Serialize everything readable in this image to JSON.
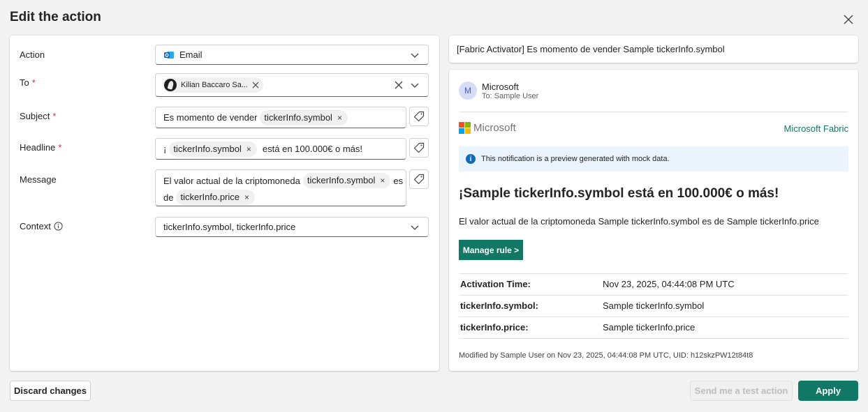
{
  "dialog": {
    "title": "Edit the action",
    "close_icon": "close-icon"
  },
  "form": {
    "action": {
      "label": "Action",
      "value": "Email",
      "icon": "outlook-icon"
    },
    "to": {
      "label": "To",
      "required_mark": "*",
      "recipient": "Kilian Baccaro Sa..."
    },
    "subject": {
      "label": "Subject",
      "required_mark": "*",
      "text_before": "Es momento de vender",
      "token": "tickerInfo.symbol"
    },
    "headline": {
      "label": "Headline",
      "required_mark": "*",
      "text_before": "¡",
      "token": "tickerInfo.symbol",
      "text_after": "está en 100.000€ o más!"
    },
    "message": {
      "label": "Message",
      "line1_text": "El valor actual de la criptomoneda",
      "line1_token": "tickerInfo.symbol",
      "line1_after": "es",
      "line2_text": "de",
      "line2_token": "tickerInfo.price"
    },
    "context": {
      "label": "Context",
      "value": "tickerInfo.symbol, tickerInfo.price"
    },
    "token_remove": "×"
  },
  "preview": {
    "subject": "[Fabric Activator] Es momento de vender Sample tickerInfo.symbol",
    "sender_initial": "M",
    "sender_name": "Microsoft",
    "sender_to": "To: Sample User",
    "ms_logo_text": "Microsoft",
    "fabric_brand": "Microsoft Fabric",
    "notice_icon": "i",
    "notice": "This notification is a preview generated with mock data.",
    "headline": "¡Sample tickerInfo.symbol está en 100.000€ o más!",
    "message": "El valor actual de la criptomoneda Sample tickerInfo.symbol es de Sample tickerInfo.price",
    "manage_button": "Manage rule >",
    "details": [
      {
        "key": "Activation Time:",
        "value": "Nov 23, 2025, 04:44:08 PM UTC"
      },
      {
        "key": "tickerInfo.symbol:",
        "value": "Sample tickerInfo.symbol"
      },
      {
        "key": "tickerInfo.price:",
        "value": "Sample tickerInfo.price"
      }
    ],
    "modified": "Modified by Sample User on Nov 23, 2025, 04:44:08 PM UTC, UID: h12skzPW12t84t8"
  },
  "footer": {
    "discard": "Discard changes",
    "test": "Send me a test action",
    "apply": "Apply"
  },
  "colors": {
    "accent": "#117865",
    "outlook_blue": "#0f6cbd",
    "required": "#c4314b"
  }
}
